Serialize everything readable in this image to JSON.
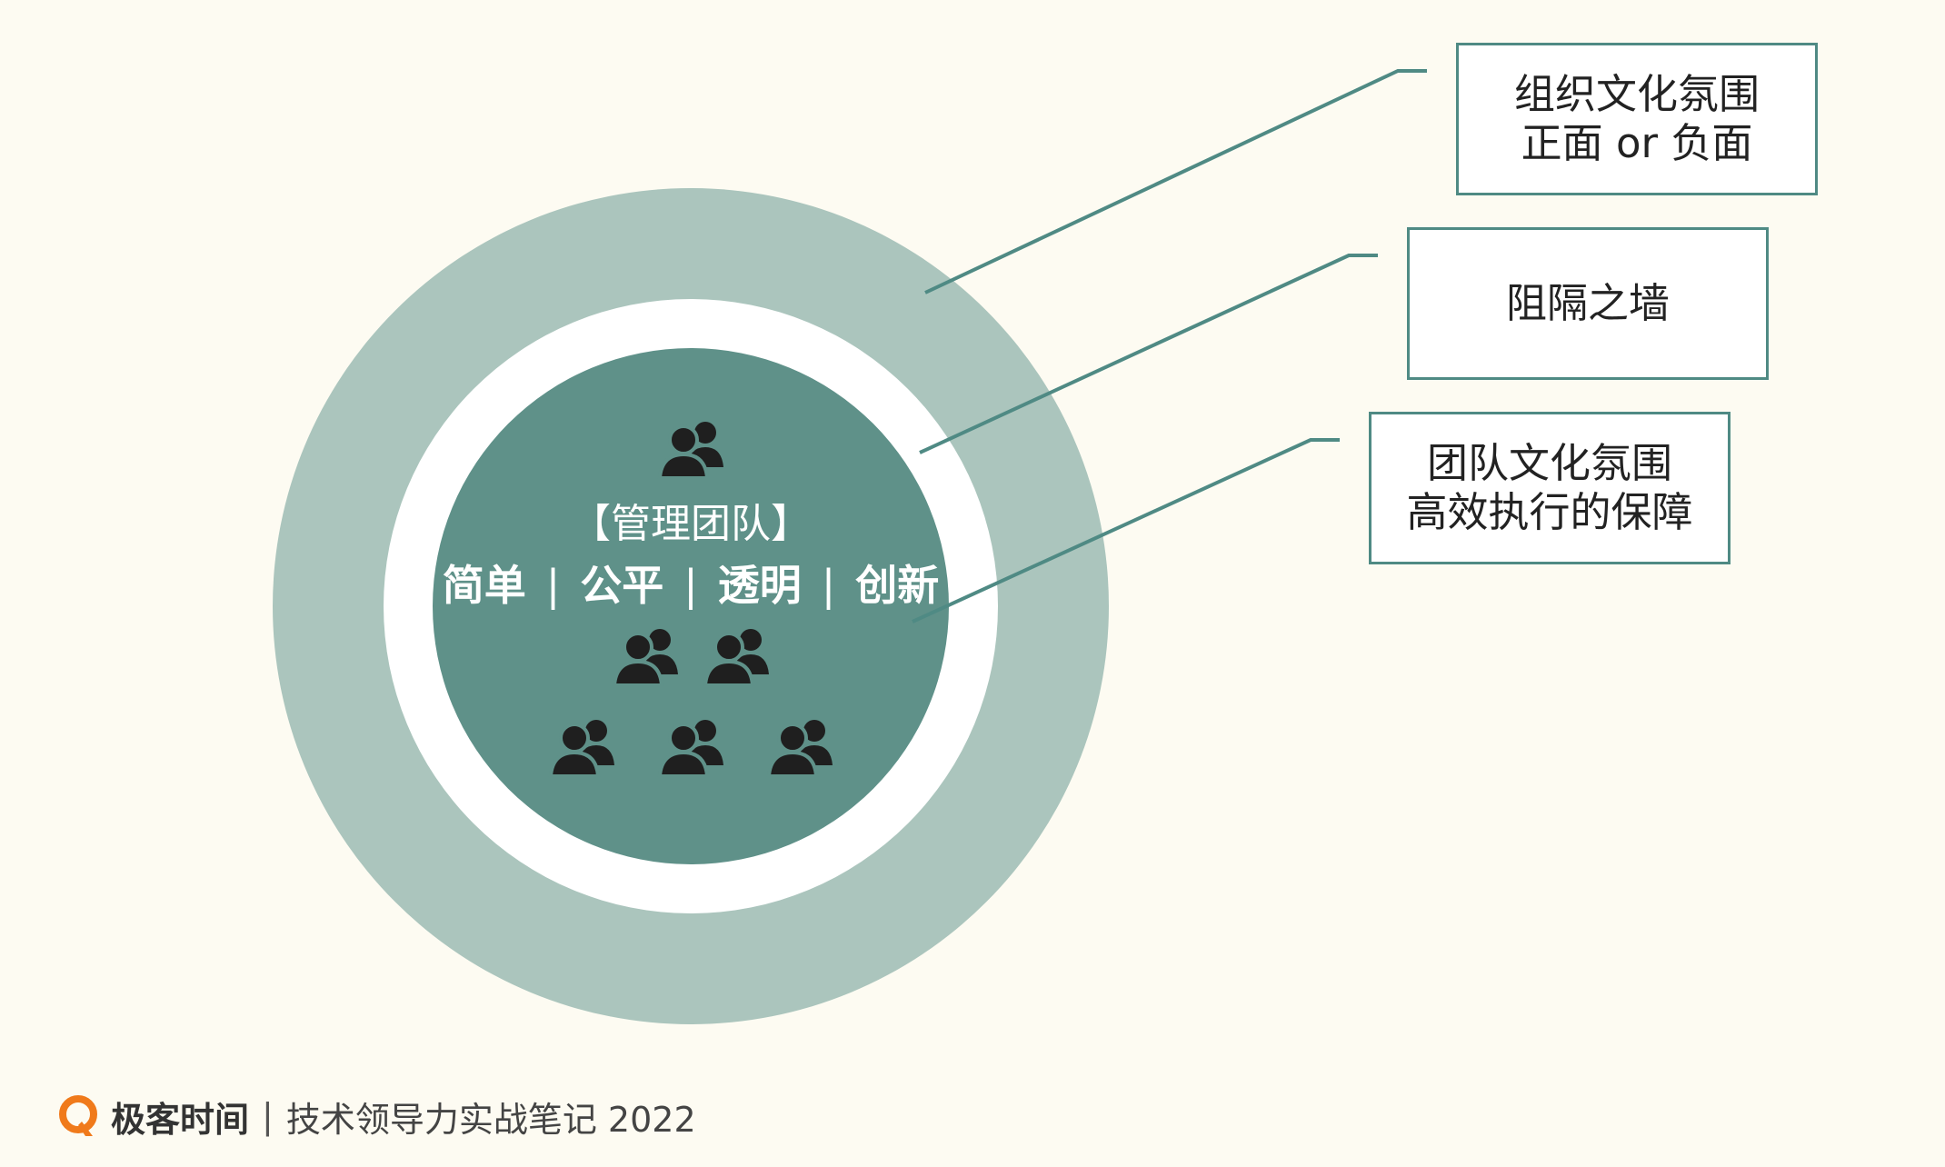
{
  "colors": {
    "background": "#fdfbf2",
    "outer_ring": "#abc5bd",
    "middle_ring": "#ffffff",
    "core_circle": "#5f9189",
    "connector_line": "#4f8a84",
    "box_border": "#4f8a84",
    "people_icon": "#1f1f1f",
    "logo_orange": "#f07a1b"
  },
  "core": {
    "title": "【管理团队】",
    "values": [
      "简单",
      "公平",
      "透明",
      "创新"
    ],
    "separator": "|",
    "icon": "people-group-icon"
  },
  "callouts": {
    "org_culture": {
      "line1": "组织文化氛围",
      "line2": "正面 or 负面"
    },
    "wall": {
      "line1": "阻隔之墙"
    },
    "team_culture": {
      "line1": "团队文化氛围",
      "line2": "高效执行的保障"
    }
  },
  "footer": {
    "logo_icon": "geektime-logo-icon",
    "brand": "极客时间",
    "divider": "|",
    "course": "技术领导力实战笔记 2022"
  }
}
